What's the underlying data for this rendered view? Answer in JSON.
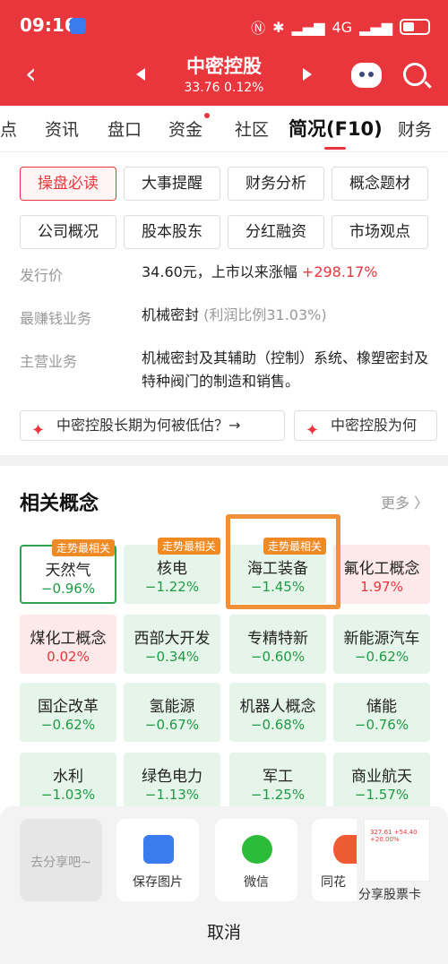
{
  "status": {
    "time": "09:16",
    "signal": "4G",
    "battery_level": 0.3
  },
  "header": {
    "back_icon": "chevron-left-icon",
    "title": "中密控股",
    "price": "33.76 0.12%"
  },
  "tabs": [
    "点",
    "资讯",
    "盘口",
    "资金",
    "社区",
    "简况(F10)",
    "财务"
  ],
  "chips": [
    "操盘必读",
    "大事提醒",
    "财务分析",
    "概念题材",
    "公司概况",
    "股本股东",
    "分红融资",
    "市场观点"
  ],
  "info": {
    "issue_label": "发行价",
    "issue_value": "34.60元，上市以来涨幅",
    "issue_change": "+298.17%",
    "profit_label": "最赚钱业务",
    "profit_value": "机械密封",
    "profit_note": "(利润比例31.03%)",
    "main_label": "主营业务",
    "main_value": "机械密封及其辅助（控制）系统、橡塑密封及特种阀门的制造和销售。"
  },
  "questions": [
    "中密控股长期为何被低估？→",
    "中密控股为何"
  ],
  "concepts": {
    "title": "相关概念",
    "more": "更多 〉",
    "badge": "走势最相关",
    "items": [
      {
        "name": "天然气",
        "value": "−0.96%"
      },
      {
        "name": "核电",
        "value": "−1.22%"
      },
      {
        "name": "海工装备",
        "value": "−1.45%"
      },
      {
        "name": "氟化工概念",
        "value": "1.97%"
      },
      {
        "name": "煤化工概念",
        "value": "0.02%"
      },
      {
        "name": "西部大开发",
        "value": "−0.34%"
      },
      {
        "name": "专精特新",
        "value": "−0.60%"
      },
      {
        "name": "新能源汽车",
        "value": "−0.62%"
      },
      {
        "name": "国企改革",
        "value": "−0.62%"
      },
      {
        "name": "氢能源",
        "value": "−0.67%"
      },
      {
        "name": "机器人概念",
        "value": "−0.68%"
      },
      {
        "name": "储能",
        "value": "−0.76%"
      },
      {
        "name": "水利",
        "value": "−1.03%"
      },
      {
        "name": "绿色电力",
        "value": "−1.13%"
      },
      {
        "name": "军工",
        "value": "−1.25%"
      },
      {
        "name": "商业航天",
        "value": "−1.57%"
      }
    ]
  },
  "share": {
    "placeholder": "去分享吧~",
    "save_image": "保存图片",
    "wechat": "微信",
    "tonghua": "同花",
    "stock_card": "分享股票卡",
    "stock_thumb_text": "327.61 +54.40 +20.00%",
    "cancel": "取消"
  },
  "colors": {
    "brand": "#e8363c",
    "down": "#1f9a45",
    "highlight": "#f0913a"
  }
}
